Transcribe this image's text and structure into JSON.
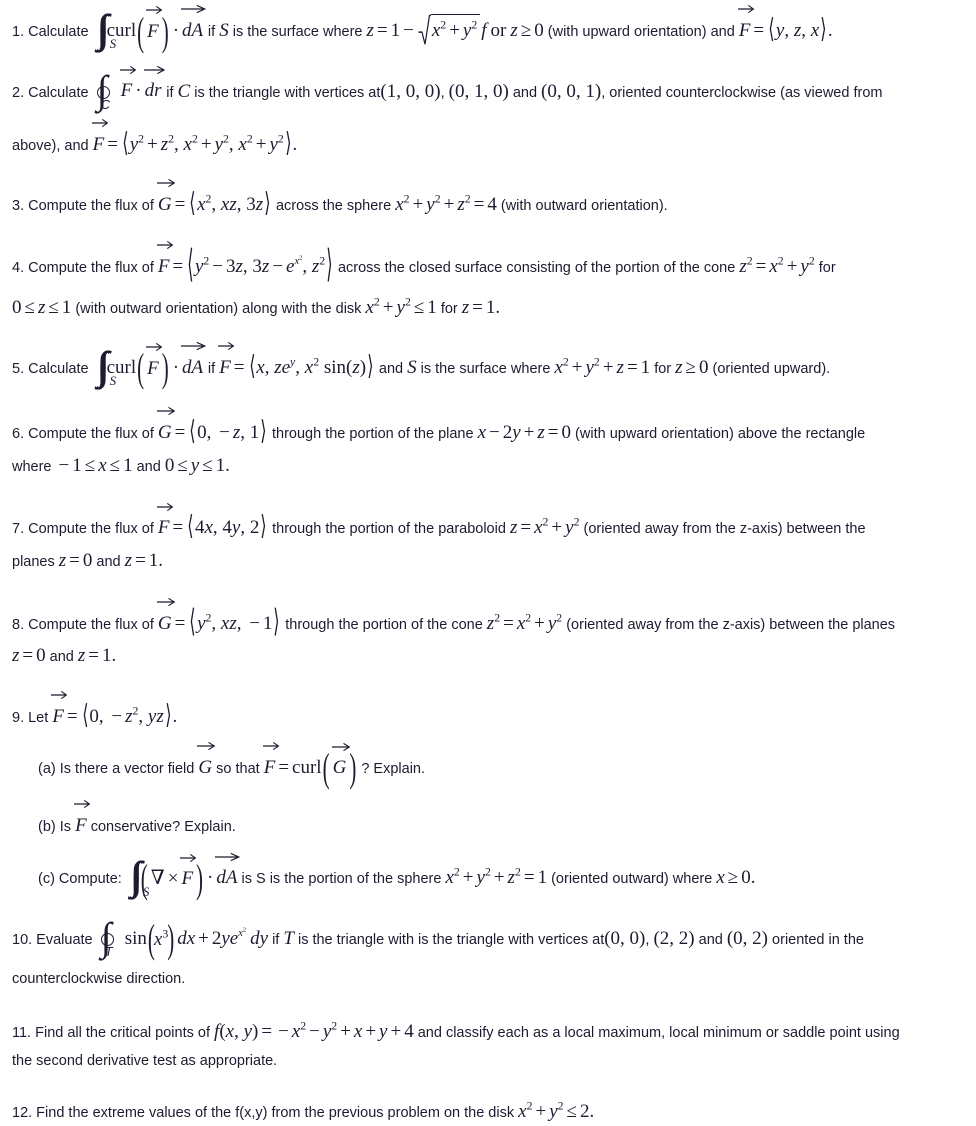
{
  "document": {
    "type": "math-problem-set",
    "topic": "Vector Calculus — Stokes' Theorem, Divergence Theorem, Green's Theorem, Optimization",
    "text_color": "#1c1c30",
    "background_color": "#ffffff",
    "problem_count": 12
  },
  "problems": [
    {
      "number": "1.",
      "verb": "Calculate",
      "plain": "Calculate ∬_S curl(F⃗) · dA⃗ if S is the surface where z = 1 − √(x²+y²) f or z ≥ 0 (with upward orientation) and F⃗ = ⟨y, z, x⟩.",
      "segments": {
        "lead": "1. Calculate",
        "integral_limit": "S",
        "curl_label": "curl",
        "field_letter": "F",
        "dA": "dA",
        "if_text": "if",
        "S_letter": "S",
        "is_surface_where": "is the surface where",
        "surface_eq_lhs": "z = 1 −",
        "radicand": "x² + y²",
        "stray_f": "f",
        "or_text": "or",
        "z_condition": "z ≥ 0",
        "orientation_note": "(with upward orientation) and",
        "vector_field": "⟨y, z, x⟩",
        "period": "."
      }
    },
    {
      "number": "2.",
      "plain": "Calculate ∮_C F⃗ · dr⃗ if C is the triangle with vertices at (1,0,0), (0,1,0) and (0,0,1), oriented counterclockwise (as viewed from above), and F⃗ = ⟨y²+z², x²+y², x²+y²⟩.",
      "segments": {
        "lead": "2. Calculate",
        "contour_limit": "C",
        "field_letter": "F",
        "dr": "dr",
        "if_text": "if",
        "C_letter": "C",
        "is_triangle": "is the triangle with vertices at",
        "vertex1": "(1, 0, 0)",
        "vertex2": "(0, 1, 0)",
        "and_text": "and",
        "vertex3": "(0, 0, 1)",
        "orient_text": ", oriented counterclockwise (as viewed from",
        "line2_lead": "above), and",
        "line2_field_letter": "F",
        "line2_vector": "⟨y² + z², x² + y², x² + y²⟩",
        "period": "."
      }
    },
    {
      "number": "3.",
      "plain": "Compute the flux of G⃗ = ⟨x², xz, 3z⟩ across the sphere x² + y² + z² = 4 (with outward orientation).",
      "segments": {
        "lead": "3. Compute the flux of",
        "field_letter": "G",
        "vector": "⟨x², xz, 3z⟩",
        "across_text": "across the sphere",
        "sphere_eq": "x² + y² + z² = 4",
        "orientation_note": "(with outward orientation)."
      }
    },
    {
      "number": "4.",
      "plain": "Compute the flux of F⃗ = ⟨y² − 3z, 3z − e^{x²}, z²⟩ across the closed surface consisting of the portion of the cone z² = x² + y² for 0 ≤ z ≤ 1 (with outward orientation) along with the disk x² + y² ≤ 1 for z = 1.",
      "segments": {
        "lead": "4. Compute the flux of",
        "field_letter": "F",
        "vector": "⟨y² − 3z, 3z − e^{x²}, z²⟩",
        "across_text": "across the closed surface consisting of the portion of the cone",
        "cone_eq": "z² = x² + y²",
        "for_text": "for",
        "range": "0 ≤ z ≤ 1",
        "orientation_note": "(with outward orientation) along with the disk",
        "disk_eq": "x² + y² ≤ 1",
        "for_z": "for",
        "z_val": "z = 1",
        "period": "."
      }
    },
    {
      "number": "5.",
      "plain": "Calculate ∬_S curl(F⃗) · dA⃗ if F⃗ = ⟨x, ze^y, x² sin(z)⟩ and S is the surface where x² + y² + z = 1 for z ≥ 0 (oriented upward).",
      "segments": {
        "lead": "5. Calculate",
        "integral_limit": "S",
        "curl_label": "curl",
        "field_letter": "F",
        "dA": "dA",
        "if_text": "if",
        "field_letter2": "F",
        "vector": "⟨x, zeʸ, x² sin(z)⟩",
        "and_text": "and",
        "S_letter": "S",
        "is_surface_where": "is the surface where",
        "surface_eq": "x² + y² + z = 1",
        "for_text": "for",
        "z_condition": "z ≥ 0",
        "orientation_note": "(oriented upward)."
      }
    },
    {
      "number": "6.",
      "plain": "Compute the flux of G⃗ = ⟨0, −z, 1⟩ through the portion of the plane x − 2y + z = 0 (with upward orientation) above the rectangle where −1 ≤ x ≤ 1 and 0 ≤ y ≤ 1.",
      "segments": {
        "lead": "6. Compute the flux of",
        "field_letter": "G",
        "vector": "⟨0, − z, 1⟩",
        "through_text": "through the portion of the plane",
        "plane_eq": "x − 2y + z = 0",
        "orientation_note": "(with upward orientation) above the rectangle",
        "line2_lead": "where",
        "range_x": "−1 ≤ x ≤ 1",
        "and_text": "and",
        "range_y": "0 ≤ y ≤ 1",
        "period": "."
      }
    },
    {
      "number": "7.",
      "plain": "Compute the flux of F⃗ = ⟨4x, 4y, 2⟩ through the portion of the paraboloid z = x² + y² (oriented away from the z-axis) between the planes z = 0 and z = 1.",
      "segments": {
        "lead": "7. Compute the flux of",
        "field_letter": "F",
        "vector": "⟨4x, 4y, 2⟩",
        "through_text": "through the portion of the paraboloid",
        "paraboloid_eq": "z = x² + y²",
        "orientation_note": "(oriented away from the z-axis) between the",
        "line2_lead": "planes",
        "z0": "z = 0",
        "and_text": "and",
        "z1": "z = 1",
        "period": "."
      }
    },
    {
      "number": "8.",
      "plain": "Compute the flux of G⃗ = ⟨y², xz, −1⟩ through the portion of the cone z² = x² + y² (oriented away from the z-axis) between the planes z = 0 and z = 1.",
      "segments": {
        "lead": "8. Compute the flux of",
        "field_letter": "G",
        "vector": "⟨y², xz, −1⟩",
        "through_text": "through the portion of the cone",
        "cone_eq": "z² = x² + y²",
        "orientation_note": "(oriented away from the z-axis) between the planes",
        "z0": "z = 0",
        "and_text": "and",
        "z1": "z = 1",
        "period": "."
      }
    },
    {
      "number": "9.",
      "plain": "Let F⃗ = ⟨0, −z², yz⟩.",
      "segments": {
        "lead": "9. Let",
        "field_letter": "F",
        "vector": "⟨0, − z², yz⟩",
        "period": "."
      },
      "parts": [
        {
          "label": "(a)",
          "plain": "Is there a vector field G⃗ so that F⃗ = curl(G⃗)? Explain.",
          "segments": {
            "lead": "(a) Is there a vector field",
            "G_letter": "G",
            "so_that": "so that",
            "F_letter": "F",
            "eq": "=",
            "curl_label": "curl",
            "G_letter2": "G",
            "tail": "? Explain."
          }
        },
        {
          "label": "(b)",
          "plain": "Is F⃗ conservative? Explain.",
          "segments": {
            "lead": "(b) Is",
            "F_letter": "F",
            "tail": "conservative? Explain."
          }
        },
        {
          "label": "(c)",
          "plain": "Compute: ∬_S (∇ × F⃗) · dA⃗ is S is the portion of the sphere x² + y² + z² = 1 (oriented outward) where x ≥ 0.",
          "segments": {
            "lead": "(c) Compute:",
            "integral_limit": "S",
            "nabla": "∇",
            "times": "×",
            "F_letter": "F",
            "dA": "dA",
            "is_text": "is S is the portion of the sphere",
            "sphere_eq": "x² + y² + z² = 1",
            "orientation_note": "(oriented outward) where",
            "x_condition": "x ≥ 0",
            "period": "."
          }
        }
      ]
    },
    {
      "number": "10.",
      "plain": "Evaluate ∮_T sin(x³) dx + 2ye^{x²} dy if T is the triangle with is the triangle with vertices at (0,0), (2,2) and (0,2) oriented in the counterclockwise direction.",
      "segments": {
        "lead": "10. Evaluate",
        "contour_limit": "T",
        "integrand": "sin(x³) dx + 2ye^{x²} dy",
        "if_text": "if",
        "T_letter": "T",
        "is_triangle": "is the triangle with is the triangle with vertices at",
        "vertex1": "(0, 0)",
        "vertex2": "(2, 2)",
        "and_text": "and",
        "vertex3": "(0, 2)",
        "orient_text": "oriented in the",
        "line2": "counterclockwise direction."
      }
    },
    {
      "number": "11.",
      "plain": "Find all the critical points of f(x, y) = −x² − y² + x + y + 4 and classify each as a local maximum, local minimum or saddle point using the second derivative test as appropriate.",
      "segments": {
        "lead": "11. Find all the critical points of",
        "function_eq": "f(x, y) = − x² − y² + x + y + 4",
        "tail": "and classify each as a local maximum, local minimum or saddle point using",
        "line2": "the second derivative test as appropriate."
      }
    },
    {
      "number": "12.",
      "plain": "Find the extreme values of the f(x,y) from the previous problem on the disk x² + y² ≤ 2.",
      "segments": {
        "lead": "12. Find the extreme values of the f(x,y) from the previous problem on the disk",
        "disk_eq": "x² + y² ≤ 2",
        "period": "."
      }
    }
  ]
}
